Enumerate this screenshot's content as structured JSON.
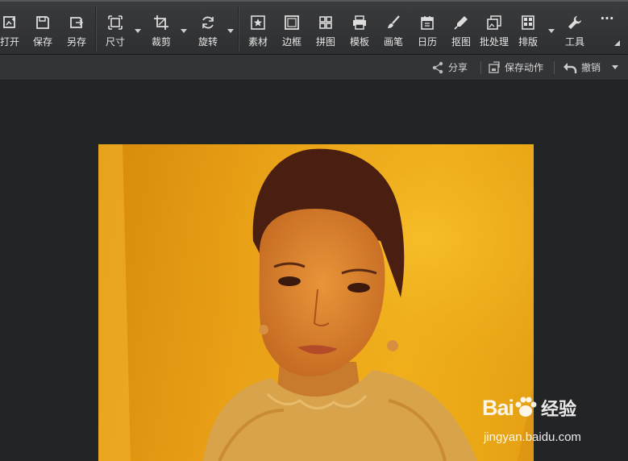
{
  "toolbar": {
    "open": "打开",
    "save": "保存",
    "save_as": "另存",
    "size": "尺寸",
    "crop": "裁剪",
    "rotate": "旋转",
    "material": "素材",
    "border": "边框",
    "collage": "拼图",
    "template": "模板",
    "brush": "画笔",
    "calendar": "日历",
    "cutout": "抠图",
    "batch": "批处理",
    "layout": "排版",
    "tools": "工具",
    "more": "···"
  },
  "subbar": {
    "share": "分享",
    "save_action": "保存动作",
    "undo": "撤销"
  },
  "watermark": {
    "logo": "Bai",
    "logo_tail": "经验",
    "url": "jingyan.baidu.com"
  }
}
